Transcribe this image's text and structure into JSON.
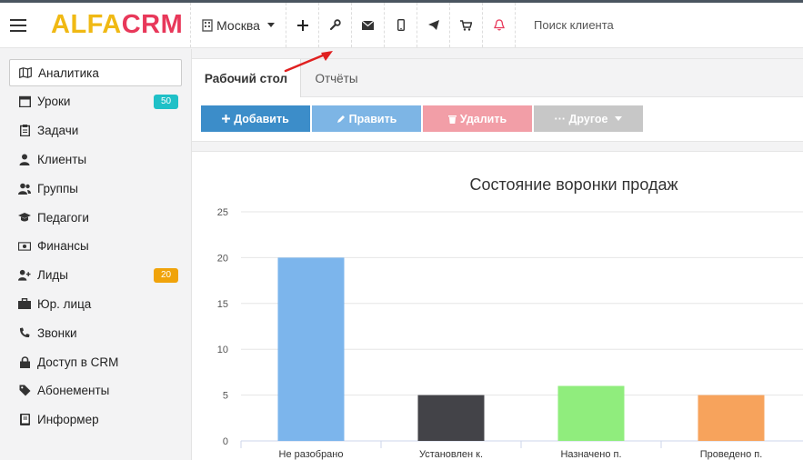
{
  "brand": {
    "alfa": "ALFA",
    "crm": "CRM"
  },
  "topbar": {
    "city": "Москва",
    "search_label": "Поиск клиента"
  },
  "sidebar": {
    "items": [
      {
        "label": "Аналитика",
        "icon": "map-icon"
      },
      {
        "label": "Уроки",
        "icon": "calendar-icon",
        "badge": "50",
        "badge_color": "#1fc0c7"
      },
      {
        "label": "Задачи",
        "icon": "clipboard-icon"
      },
      {
        "label": "Клиенты",
        "icon": "user-icon"
      },
      {
        "label": "Группы",
        "icon": "users-icon"
      },
      {
        "label": "Педагоги",
        "icon": "graduation-cap-icon"
      },
      {
        "label": "Финансы",
        "icon": "money-icon"
      },
      {
        "label": "Лиды",
        "icon": "user-plus-icon",
        "badge": "20",
        "badge_color": "#f0a30a"
      },
      {
        "label": "Юр. лица",
        "icon": "briefcase-icon"
      },
      {
        "label": "Звонки",
        "icon": "phone-icon"
      },
      {
        "label": "Доступ в CRM",
        "icon": "lock-icon"
      },
      {
        "label": "Абонементы",
        "icon": "tag-icon"
      },
      {
        "label": "Информер",
        "icon": "book-icon"
      }
    ]
  },
  "tabs": {
    "desktop": "Рабочий стол",
    "reports": "Отчёты"
  },
  "toolbar": {
    "add": "Добавить",
    "edit": "Править",
    "delete": "Удалить",
    "other": "··· Другое"
  },
  "colors": {
    "add": "#3c8dc9",
    "edit": "#7db5e5",
    "delete": "#f29ea7",
    "other": "#c7c7c7"
  },
  "chart_data": {
    "type": "bar",
    "title": "Состояние воронки продаж",
    "categories": [
      "Не разобрано",
      "Установлен к.",
      "Назначено п.",
      "Проведено п."
    ],
    "values": [
      20,
      5,
      6,
      5
    ],
    "colors": [
      "#7cb5ec",
      "#434348",
      "#90ed7d",
      "#f7a35c"
    ],
    "ylim": [
      0,
      25
    ],
    "yticks": [
      "0",
      "5",
      "10",
      "15",
      "20",
      "25"
    ],
    "grid": true
  }
}
